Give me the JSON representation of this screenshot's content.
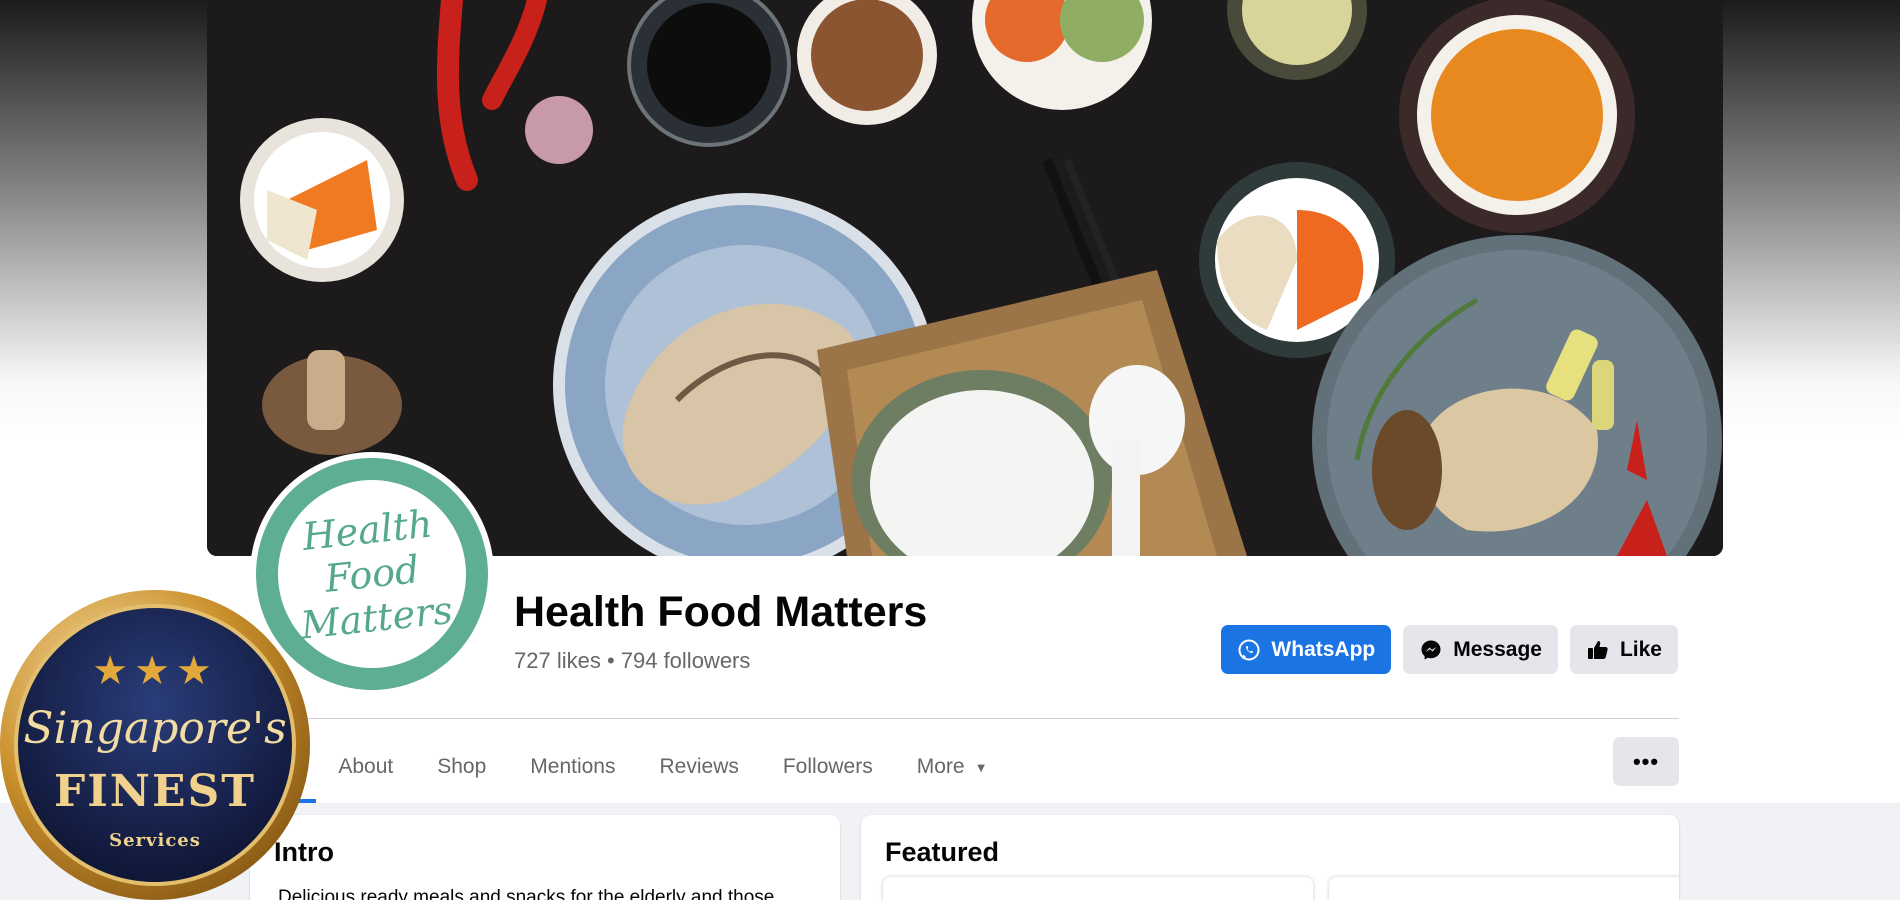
{
  "page": {
    "name": "Health Food Matters",
    "stats": "727 likes • 794 followers"
  },
  "avatar": {
    "logo_line1": "Health",
    "logo_line2": "Food",
    "logo_line3": "Matters"
  },
  "actions": {
    "whatsapp_label": "WhatsApp",
    "message_label": "Message",
    "like_label": "Like"
  },
  "tabs": [
    {
      "label": "Posts",
      "visible_label": "ts",
      "active": true
    },
    {
      "label": "About"
    },
    {
      "label": "Shop"
    },
    {
      "label": "Mentions"
    },
    {
      "label": "Reviews"
    },
    {
      "label": "Followers"
    },
    {
      "label": "More"
    }
  ],
  "more_button_label": "•••",
  "intro": {
    "title": "Intro",
    "text": "Delicious ready meals and snacks for the elderly and those"
  },
  "featured": {
    "title": "Featured"
  },
  "badge": {
    "stars": "★★★",
    "line1": "Singapore's",
    "line2": "FINEST",
    "line3": "Services"
  },
  "colors": {
    "accent": "#1b74e4",
    "logo_green": "#5eae93",
    "badge_gold": "#e3bf6d",
    "badge_navy": "#121a3d"
  }
}
